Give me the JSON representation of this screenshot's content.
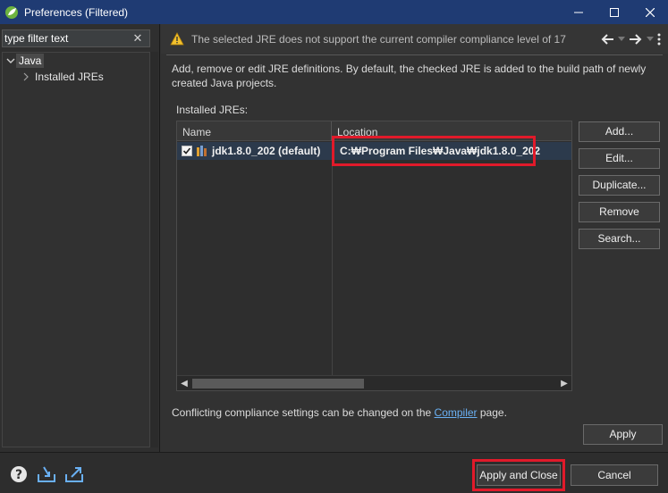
{
  "window": {
    "title": "Preferences (Filtered)",
    "app_icon": "eclipse-spring-icon",
    "controls": [
      "minimize-icon",
      "maximize-icon",
      "close-icon"
    ]
  },
  "sidebar": {
    "filter_placeholder": "type filter text",
    "tree": [
      {
        "label": "Java",
        "expanded": true,
        "selected": true
      },
      {
        "label": "Installed JREs",
        "expanded": false,
        "selected": false
      }
    ]
  },
  "header": {
    "message": "The selected JRE does not support the current compiler compliance level of 17",
    "message_icon": "warning-icon"
  },
  "content": {
    "description": "Add, remove or edit JRE definitions. By default, the checked JRE is added to the build path of newly created Java projects.",
    "installed_label": "Installed JREs:",
    "table": {
      "columns": [
        "Name",
        "Location"
      ],
      "rows": [
        {
          "checked": true,
          "name": "jdk1.8.0_202 (default)",
          "location": "C:₩Program Files₩Java₩jdk1.8.0_202"
        }
      ]
    },
    "buttons": {
      "add": "Add...",
      "edit": "Edit...",
      "duplicate": "Duplicate...",
      "remove": "Remove",
      "search": "Search..."
    },
    "conflict_before": "Conflicting compliance settings can be changed on the ",
    "conflict_link": "Compiler",
    "conflict_after": " page.",
    "apply": "Apply"
  },
  "footer": {
    "apply_and_close": "Apply and Close",
    "cancel": "Cancel"
  },
  "colors": {
    "titlebar": "#1f3b73",
    "highlight": "#e11a2a",
    "link": "#6ab0f3",
    "selected_row": "#2c3a4c"
  }
}
